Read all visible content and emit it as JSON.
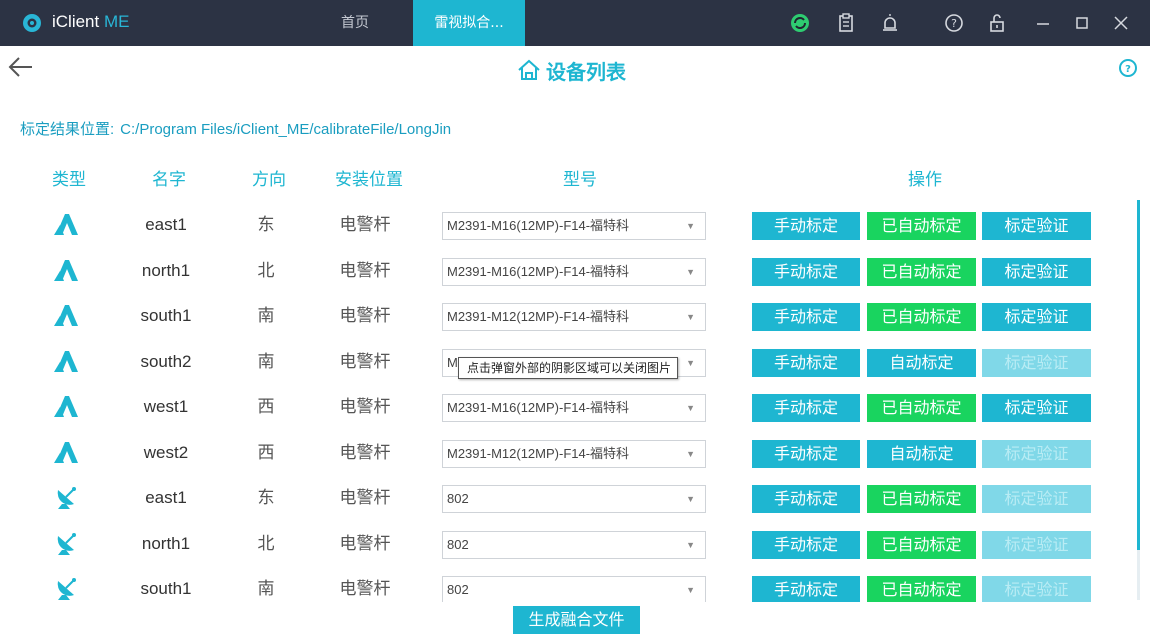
{
  "app": {
    "title_main": "iClient",
    "title_accent": "ME"
  },
  "tabs": [
    {
      "label": "首页"
    },
    {
      "label": "雷视拟合..."
    }
  ],
  "titlebar_icons": [
    "refresh-icon",
    "clipboard-icon",
    "alarm-icon",
    "question-icon",
    "unlock-icon",
    "minimize-icon",
    "maximize-icon",
    "close-icon"
  ],
  "header": {
    "title": "设备列表"
  },
  "calibration": {
    "label": "标定结果位置:",
    "path": "C:/Program Files/iClient_ME/calibrateFile/LongJin"
  },
  "columns": {
    "type": "类型",
    "name": "名字",
    "direction": "方向",
    "position": "安装位置",
    "model": "型号",
    "actions": "操作"
  },
  "buttons": {
    "manual": "手动标定",
    "auto_done": "已自动标定",
    "auto": "自动标定",
    "verify": "标定验证",
    "generate": "生成融合文件"
  },
  "tooltip": "点击弹窗外部的阴影区域可以关闭图片",
  "rows": [
    {
      "type": "radar",
      "name": "east1",
      "direction": "东",
      "position": "电警杆",
      "model": "M2391-M16(12MP)-F14-福特科",
      "auto_done": true,
      "verify_enabled": true
    },
    {
      "type": "radar",
      "name": "north1",
      "direction": "北",
      "position": "电警杆",
      "model": "M2391-M16(12MP)-F14-福特科",
      "auto_done": true,
      "verify_enabled": true
    },
    {
      "type": "radar",
      "name": "south1",
      "direction": "南",
      "position": "电警杆",
      "model": "M2391-M12(12MP)-F14-福特科",
      "auto_done": true,
      "verify_enabled": true
    },
    {
      "type": "radar",
      "name": "south2",
      "direction": "南",
      "position": "电警杆",
      "model": "M",
      "auto_done": false,
      "verify_enabled": false
    },
    {
      "type": "radar",
      "name": "west1",
      "direction": "西",
      "position": "电警杆",
      "model": "M2391-M16(12MP)-F14-福特科",
      "auto_done": true,
      "verify_enabled": true
    },
    {
      "type": "radar",
      "name": "west2",
      "direction": "西",
      "position": "电警杆",
      "model": "M2391-M12(12MP)-F14-福特科",
      "auto_done": false,
      "verify_enabled": false
    },
    {
      "type": "dish",
      "name": "east1",
      "direction": "东",
      "position": "电警杆",
      "model": "802",
      "auto_done": true,
      "verify_enabled": false
    },
    {
      "type": "dish",
      "name": "north1",
      "direction": "北",
      "position": "电警杆",
      "model": "802",
      "auto_done": true,
      "verify_enabled": false
    },
    {
      "type": "dish",
      "name": "south1",
      "direction": "南",
      "position": "电警杆",
      "model": "802",
      "auto_done": true,
      "verify_enabled": false
    }
  ],
  "colors": {
    "accent": "#1eb6d1",
    "success": "#19d45f",
    "titlebar": "#2c3344"
  }
}
